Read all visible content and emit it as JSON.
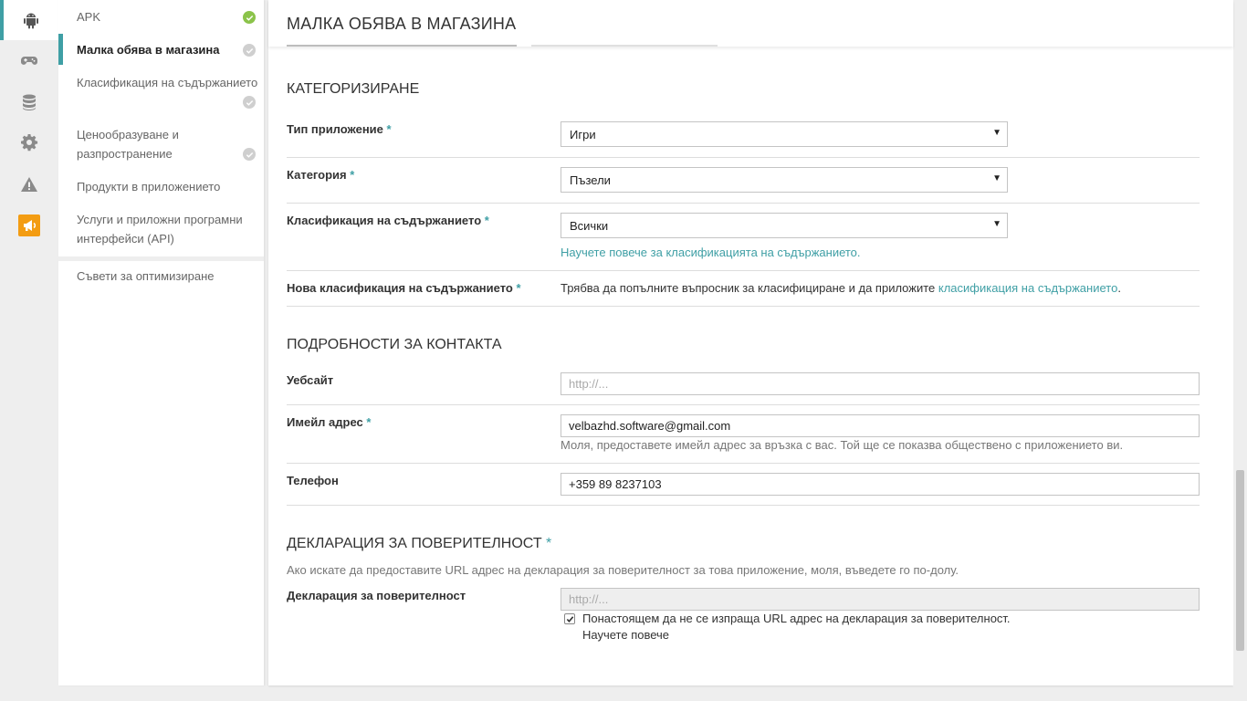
{
  "rail": {
    "items": [
      {
        "icon": "android-icon",
        "active": true
      },
      {
        "icon": "gamepad-icon"
      },
      {
        "icon": "database-icon"
      },
      {
        "icon": "gear-icon"
      },
      {
        "icon": "warning-icon"
      },
      {
        "icon": "megaphone-icon",
        "color": "#f39c12"
      }
    ]
  },
  "subnav": {
    "items": [
      {
        "label": "APK",
        "status": "complete"
      },
      {
        "label": "Малка обява в магазина",
        "status": "pending",
        "active": true
      },
      {
        "label": "Класификация на съдържанието",
        "status": "pending"
      },
      {
        "label": "Ценообразуване и разпространение",
        "status": "pending"
      },
      {
        "label": "Продукти в приложението"
      },
      {
        "label": "Услуги и приложни програмни интерфейси (API)"
      },
      {
        "label": "Съвети за оптимизиране"
      }
    ]
  },
  "header": {
    "title": "МАЛКА ОБЯВА В МАГАЗИНА"
  },
  "categorization": {
    "title": "КАТЕГОРИЗИРАНЕ",
    "app_type": {
      "label": "Тип приложение",
      "req": "*",
      "value": "Игри"
    },
    "category": {
      "label": "Категория",
      "req": "*",
      "value": "Пъзели"
    },
    "content_rating": {
      "label": "Класификация на съдържанието",
      "req": "*",
      "value": "Всички",
      "help_link": "Научете повече за класификацията на съдържанието."
    },
    "new_rating": {
      "label": "Нова класификация на съдържанието",
      "req": "*",
      "text_before": "Трябва да попълните въпросник за класифициране и да приложите ",
      "link": "класификация на съдържанието",
      "text_after": "."
    }
  },
  "contact": {
    "title": "ПОДРОБНОСТИ ЗА КОНТАКТА",
    "website": {
      "label": "Уебсайт",
      "placeholder": "http://..."
    },
    "email": {
      "label": "Имейл адрес",
      "req": "*",
      "value": "velbazhd.software@gmail.com",
      "help": "Моля, предоставете имейл адрес за връзка с вас. Той ще се показва обществено с приложението ви."
    },
    "phone": {
      "label": "Телефон",
      "value": "+359 89 8237103"
    }
  },
  "privacy": {
    "title": "ДЕКЛАРАЦИЯ ЗА ПОВЕРИТЕЛНОСТ",
    "req": "*",
    "description": "Ако искате да предоставите URL адрес на декларация за поверителност за това приложение, моля, въведете го по-долу.",
    "field_label": "Декларация за поверителност",
    "placeholder": "http://...",
    "checkbox_label": "Понастоящем да не се изпраща URL адрес на декларация за поверителност.",
    "checkbox_checked": true,
    "learn_more": "Научете повече"
  },
  "colors": {
    "accent": "#3f9fa5",
    "complete": "#8bc34a",
    "pending": "#cfcfcf",
    "promo": "#f39c12"
  }
}
